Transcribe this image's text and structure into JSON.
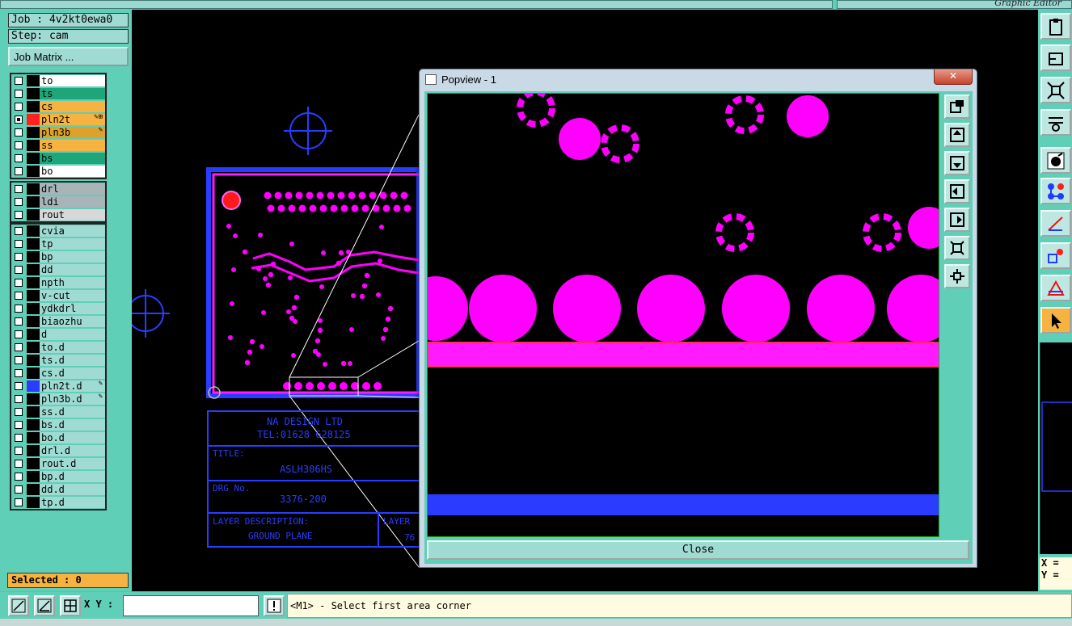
{
  "app": {
    "title": "Graphic Editor"
  },
  "job": {
    "label": "Job : 4v2kt0ewa0",
    "step": "Step: cam",
    "matrix_button": "Job Matrix ..."
  },
  "layer_groups": [
    [
      {
        "name": "to",
        "color": "#ffffff",
        "checked": false,
        "swatch": "#000000",
        "flag": ""
      },
      {
        "name": "ts",
        "color": "#1ea67a",
        "checked": false,
        "swatch": "#000000",
        "flag": ""
      },
      {
        "name": "cs",
        "color": "#f6b341",
        "checked": false,
        "swatch": "#000000",
        "flag": ""
      },
      {
        "name": "pln2t",
        "color": "#f6b341",
        "checked": true,
        "swatch": "#ff2020",
        "flag": "✎⊞"
      },
      {
        "name": "pln3b",
        "color": "#dca22c",
        "checked": false,
        "swatch": "#000000",
        "flag": "✎"
      },
      {
        "name": "ss",
        "color": "#f6b341",
        "checked": false,
        "swatch": "#000000",
        "flag": ""
      },
      {
        "name": "bs",
        "color": "#1ea67a",
        "checked": false,
        "swatch": "#000000",
        "flag": ""
      },
      {
        "name": "bo",
        "color": "#ffffff",
        "checked": false,
        "swatch": "#000000",
        "flag": ""
      }
    ],
    [
      {
        "name": "drl",
        "color": "#a9b4b8",
        "checked": false,
        "swatch": "#000000",
        "flag": ""
      },
      {
        "name": "ldi",
        "color": "#a9b4b8",
        "checked": false,
        "swatch": "#000000",
        "flag": ""
      },
      {
        "name": "rout",
        "color": "#d8d8d8",
        "checked": false,
        "swatch": "#000000",
        "flag": ""
      }
    ],
    [
      {
        "name": "cvia",
        "color": "#9fdbd3",
        "checked": false,
        "swatch": "#000000",
        "flag": ""
      },
      {
        "name": "tp",
        "color": "#9fdbd3",
        "checked": false,
        "swatch": "#000000",
        "flag": ""
      },
      {
        "name": "bp",
        "color": "#9fdbd3",
        "checked": false,
        "swatch": "#000000",
        "flag": ""
      },
      {
        "name": "dd",
        "color": "#9fdbd3",
        "checked": false,
        "swatch": "#000000",
        "flag": ""
      },
      {
        "name": "npth",
        "color": "#9fdbd3",
        "checked": false,
        "swatch": "#000000",
        "flag": ""
      },
      {
        "name": "v-cut",
        "color": "#9fdbd3",
        "checked": false,
        "swatch": "#000000",
        "flag": ""
      },
      {
        "name": "ydkdrl",
        "color": "#9fdbd3",
        "checked": false,
        "swatch": "#000000",
        "flag": ""
      },
      {
        "name": "biaozhu",
        "color": "#9fdbd3",
        "checked": false,
        "swatch": "#000000",
        "flag": ""
      },
      {
        "name": "d",
        "color": "#9fdbd3",
        "checked": false,
        "swatch": "#000000",
        "flag": ""
      },
      {
        "name": "to.d",
        "color": "#9fdbd3",
        "checked": false,
        "swatch": "#000000",
        "flag": ""
      },
      {
        "name": "ts.d",
        "color": "#9fdbd3",
        "checked": false,
        "swatch": "#000000",
        "flag": ""
      },
      {
        "name": "cs.d",
        "color": "#9fdbd3",
        "checked": false,
        "swatch": "#000000",
        "flag": ""
      },
      {
        "name": "pln2t.d",
        "color": "#9fdbd3",
        "checked": false,
        "swatch": "#2a3cff",
        "flag": "✎"
      },
      {
        "name": "pln3b.d",
        "color": "#9fdbd3",
        "checked": false,
        "swatch": "#000000",
        "flag": "✎"
      },
      {
        "name": "ss.d",
        "color": "#9fdbd3",
        "checked": false,
        "swatch": "#000000",
        "flag": ""
      },
      {
        "name": "bs.d",
        "color": "#9fdbd3",
        "checked": false,
        "swatch": "#000000",
        "flag": ""
      },
      {
        "name": "bo.d",
        "color": "#9fdbd3",
        "checked": false,
        "swatch": "#000000",
        "flag": ""
      },
      {
        "name": "drl.d",
        "color": "#9fdbd3",
        "checked": false,
        "swatch": "#000000",
        "flag": ""
      },
      {
        "name": "rout.d",
        "color": "#9fdbd3",
        "checked": false,
        "swatch": "#000000",
        "flag": ""
      },
      {
        "name": "bp.d",
        "color": "#9fdbd3",
        "checked": false,
        "swatch": "#000000",
        "flag": ""
      },
      {
        "name": "dd.d",
        "color": "#9fdbd3",
        "checked": false,
        "swatch": "#000000",
        "flag": ""
      },
      {
        "name": "tp.d",
        "color": "#9fdbd3",
        "checked": false,
        "swatch": "#000000",
        "flag": ""
      }
    ]
  ],
  "selected": "Selected : 0",
  "statusbar": {
    "xy_label": "X Y :",
    "xy_value": "",
    "hint": "<M1> - Select first area corner"
  },
  "coords": {
    "x": "X = ",
    "y": "Y = "
  },
  "title_block": {
    "company": "NA DESIGN LTD",
    "tel": "TEL:01628 628125",
    "title_label": "TITLE:",
    "title_value": "ASLH306HS",
    "drg_label": "DRG No.",
    "drg_value": "3376-200",
    "desc_label": "LAYER DESCRIPTION:",
    "desc_value": "GROUND PLANE",
    "layer_label": "LAYER",
    "layer_value": "76"
  },
  "popview": {
    "title": "Popview - 1",
    "close_label": "Close"
  },
  "colors": {
    "panel": "#5fcfb8",
    "layer_active": "#ff00ff",
    "layer_outline": "#2a3cff",
    "highlight": "#f6b341"
  }
}
